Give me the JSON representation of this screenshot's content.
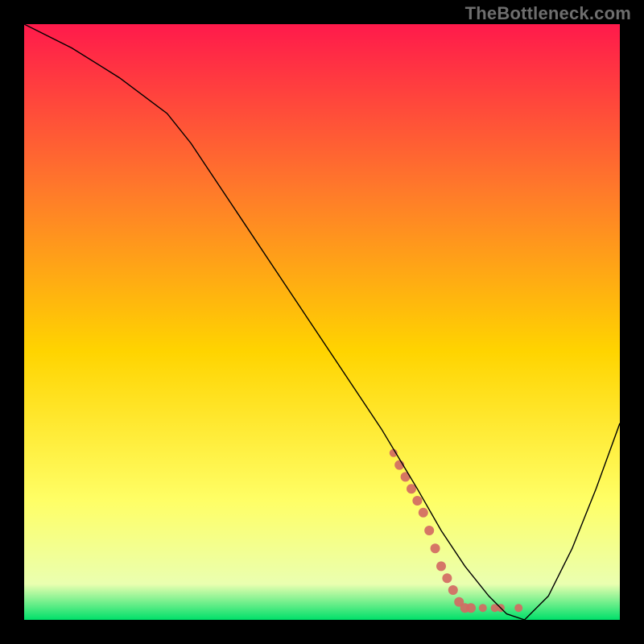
{
  "watermark": "TheBottleneck.com",
  "chart_data": {
    "type": "line",
    "title": "",
    "xlabel": "",
    "ylabel": "",
    "xlim": [
      0,
      100
    ],
    "ylim": [
      0,
      100
    ],
    "grid": false,
    "legend": false,
    "background_gradient": {
      "top_color": "#ff1a4b",
      "upper_mid_color": "#ff7a2a",
      "mid_color": "#ffd400",
      "lower_mid_color": "#ffff66",
      "near_bottom_color": "#eaffb0",
      "bottom_color": "#00e06a"
    },
    "series": [
      {
        "name": "bottleneck-curve",
        "color": "#000000",
        "stroke_width": 1.4,
        "x": [
          0,
          8,
          16,
          24,
          28,
          36,
          44,
          52,
          60,
          66,
          70,
          74,
          78,
          81,
          84,
          88,
          92,
          96,
          100
        ],
        "y": [
          100,
          96,
          91,
          85,
          80,
          68,
          56,
          44,
          32,
          22,
          15,
          9,
          4,
          1,
          0,
          4,
          12,
          22,
          33
        ]
      },
      {
        "name": "highlighted-range-marker",
        "color": "#d36a63",
        "type": "scatter",
        "points": [
          {
            "x": 62,
            "y": 28,
            "r": 5
          },
          {
            "x": 63,
            "y": 26,
            "r": 6
          },
          {
            "x": 64,
            "y": 24,
            "r": 6
          },
          {
            "x": 65,
            "y": 22,
            "r": 6
          },
          {
            "x": 66,
            "y": 20,
            "r": 6
          },
          {
            "x": 67,
            "y": 18,
            "r": 6
          },
          {
            "x": 68,
            "y": 15,
            "r": 6
          },
          {
            "x": 69,
            "y": 12,
            "r": 6
          },
          {
            "x": 70,
            "y": 9,
            "r": 6
          },
          {
            "x": 71,
            "y": 7,
            "r": 6
          },
          {
            "x": 72,
            "y": 5,
            "r": 6
          },
          {
            "x": 73,
            "y": 3,
            "r": 6
          },
          {
            "x": 74,
            "y": 2,
            "r": 6
          },
          {
            "x": 75,
            "y": 2,
            "r": 6
          },
          {
            "x": 77,
            "y": 2,
            "r": 5
          },
          {
            "x": 79,
            "y": 2,
            "r": 5
          },
          {
            "x": 80,
            "y": 2,
            "r": 5
          },
          {
            "x": 83,
            "y": 2,
            "r": 5
          }
        ]
      }
    ]
  }
}
